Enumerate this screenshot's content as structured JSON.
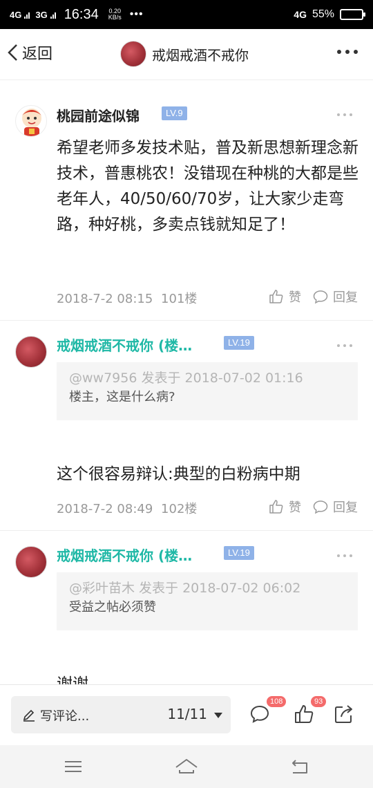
{
  "status_bar": {
    "net1": "4G",
    "net2": "3G",
    "time": "16:34",
    "speed_value": "0.20",
    "speed_unit": "KB/s",
    "dots": "•••",
    "net_right": "4G",
    "battery_percent": "55%",
    "battery_level": 0.55
  },
  "header": {
    "back_label": "返回",
    "title": "戒烟戒酒不戒你"
  },
  "posts": [
    {
      "author": "桃园前途似锦",
      "level": "LV.9",
      "content": "希望老师多发技术贴，普及新思想新理念新技术，普惠桃农！没错现在种桃的大都是些老年人，40/50/60/70岁，让大家少走弯路，种好桃，多卖点钱就知足了！",
      "time": "2018-7-2 08:15",
      "floor": "101楼",
      "like_label": "赞",
      "reply_label": "回复"
    },
    {
      "author": "戒烟戒酒不戒你 (楼…",
      "level": "LV.19",
      "quote_meta": "@ww7956 发表于 2018-07-02 01:16",
      "quote_text": "楼主，这是什么病?",
      "content": "这个很容易辩认:典型的白粉病中期",
      "time": "2018-7-2 08:49",
      "floor": "102楼",
      "like_label": "赞",
      "reply_label": "回复"
    },
    {
      "author": "戒烟戒酒不戒你 (楼…",
      "level": "LV.19",
      "quote_meta": "@彩叶苗木 发表于 2018-07-02 06:02",
      "quote_text": "受益之帖必须赞",
      "content": "谢谢"
    }
  ],
  "bottom_bar": {
    "comment_placeholder": "写评论...",
    "page_indicator": "11/11",
    "comment_count": "108",
    "like_count": "93"
  },
  "colors": {
    "accent_green": "#1fb8a6",
    "level_badge": "#8fb2e8",
    "count_badge": "#f46b6b"
  },
  "icons": [
    "back-arrow-icon",
    "more-icon",
    "like-icon",
    "reply-icon",
    "pen-icon",
    "comment-icon",
    "thumb-icon",
    "share-icon",
    "menu-icon",
    "home-icon",
    "back-nav-icon"
  ]
}
